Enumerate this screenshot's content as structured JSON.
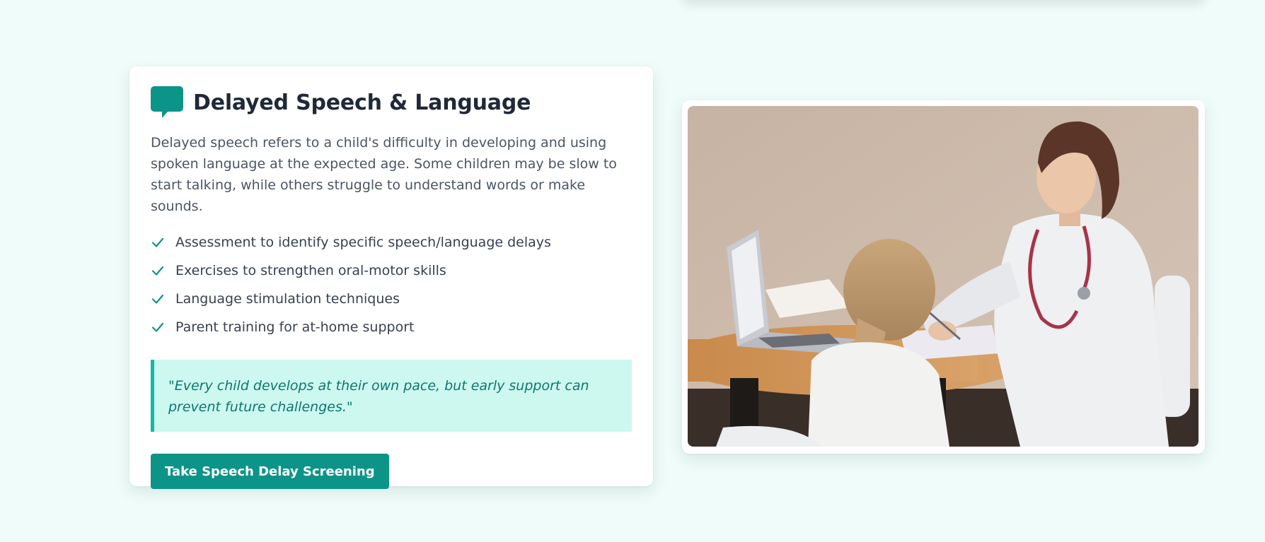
{
  "section": {
    "title": "Delayed Speech & Language",
    "description": "Delayed speech refers to a child's difficulty in developing and using spoken language at the expected age. Some children may be slow to start talking, while others struggle to understand words or make sounds.",
    "icon": "speech-bubble-icon",
    "features": [
      "Assessment to identify specific speech/language delays",
      "Exercises to strengthen oral-motor skills",
      "Language stimulation techniques",
      "Parent training for at-home support"
    ],
    "quote": "\"Every child develops at their own pace, but early support can prevent future challenges.\"",
    "cta_label": "Take Speech Delay Screening"
  },
  "colors": {
    "accent": "#0d9488",
    "accent_light": "#14b8a6",
    "quote_bg": "#ccf8ef",
    "page_bg": "#effcf9",
    "title": "#1f2937",
    "body_text": "#4b5563"
  }
}
